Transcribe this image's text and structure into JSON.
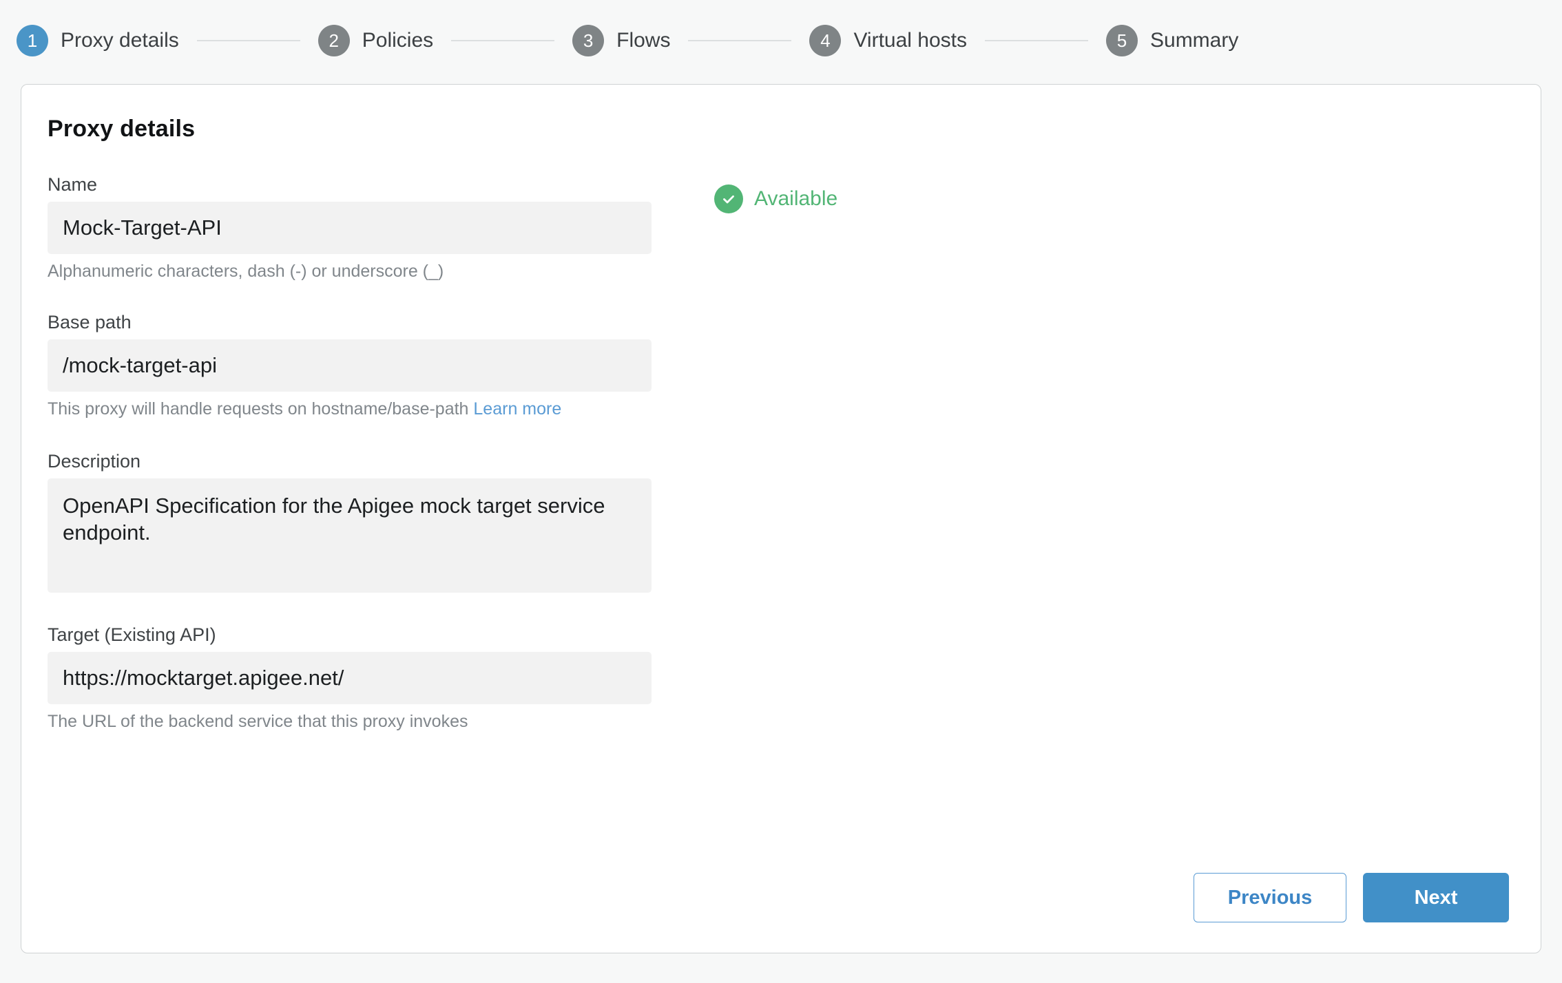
{
  "stepper": {
    "steps": [
      {
        "number": "1",
        "label": "Proxy details",
        "state": "active"
      },
      {
        "number": "2",
        "label": "Policies",
        "state": "inactive"
      },
      {
        "number": "3",
        "label": "Flows",
        "state": "inactive"
      },
      {
        "number": "4",
        "label": "Virtual hosts",
        "state": "inactive"
      },
      {
        "number": "5",
        "label": "Summary",
        "state": "inactive"
      }
    ]
  },
  "card": {
    "title": "Proxy details"
  },
  "fields": {
    "name": {
      "label": "Name",
      "value": "Mock-Target-API",
      "hint": "Alphanumeric characters, dash (-) or underscore (_)"
    },
    "base_path": {
      "label": "Base path",
      "value": "/mock-target-api",
      "hint_text": "This proxy will handle requests on hostname/base-path",
      "hint_link": "Learn more"
    },
    "description": {
      "label": "Description",
      "value": "OpenAPI Specification for the Apigee mock target service endpoint."
    },
    "target": {
      "label": "Target (Existing API)",
      "value": "https://mocktarget.apigee.net/",
      "hint": "The URL of the backend service that this proxy invokes"
    }
  },
  "availability": {
    "icon": "check-circle-icon",
    "text": "Available"
  },
  "footer": {
    "previous_label": "Previous",
    "next_label": "Next"
  },
  "colors": {
    "accent_blue": "#4190c8",
    "step_active": "#4a95c7",
    "step_inactive": "#7f8486",
    "success_green": "#52b575",
    "link_blue": "#5a9bd4",
    "page_bg": "#f7f8f8",
    "input_bg": "#f2f2f2"
  }
}
